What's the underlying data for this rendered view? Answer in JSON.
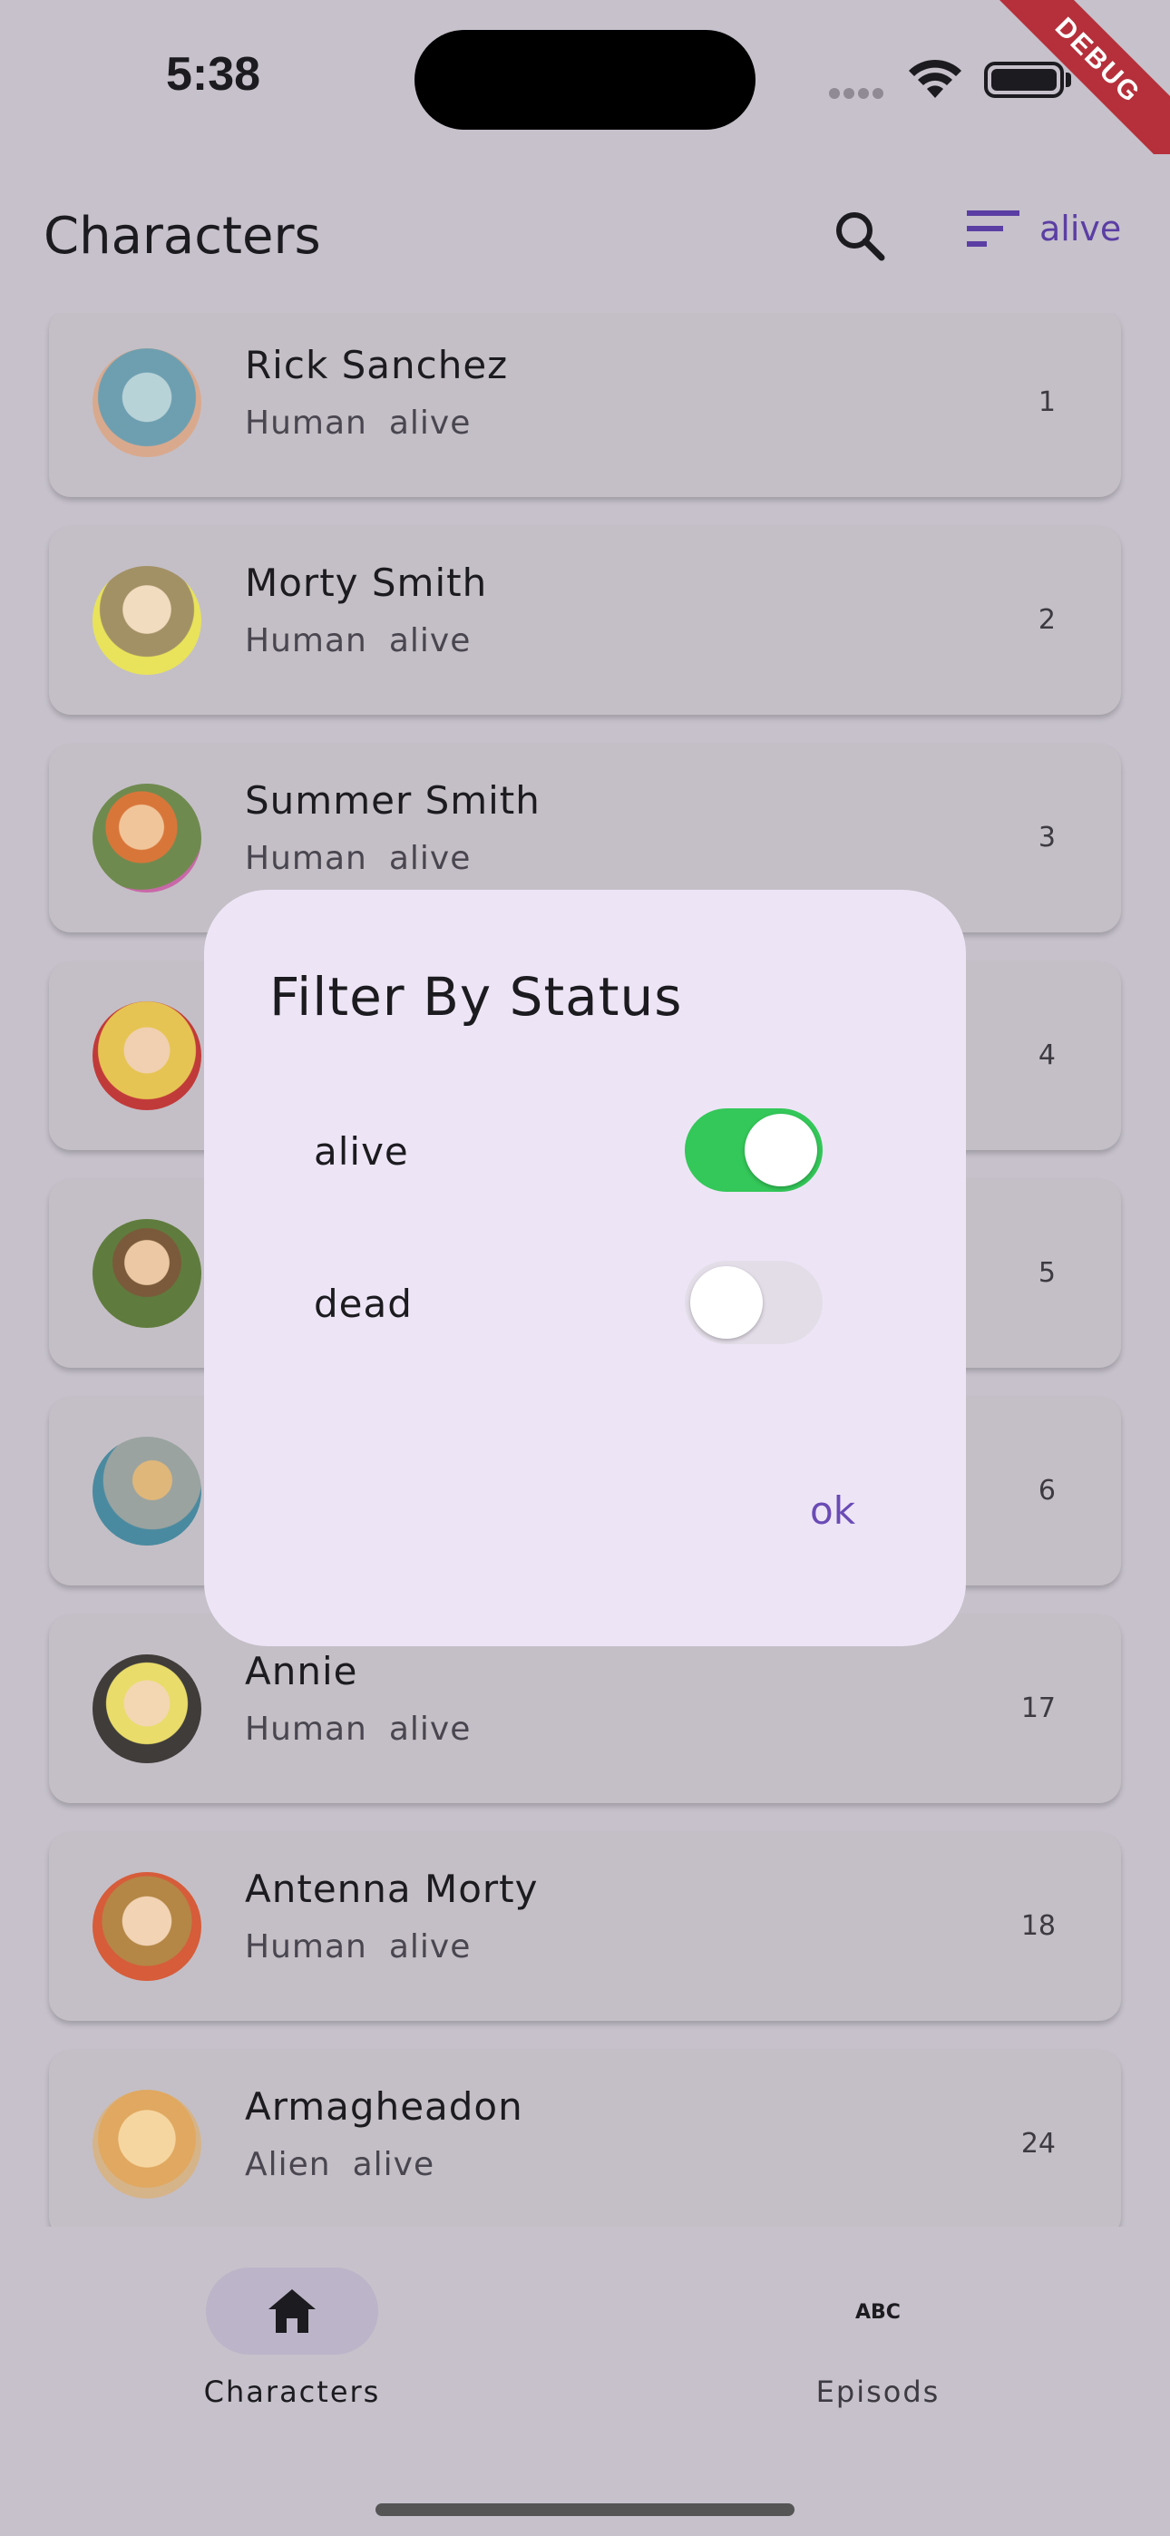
{
  "status_bar": {
    "time": "5:38",
    "debug": "DEBUG"
  },
  "app_bar": {
    "title": "Characters",
    "search_icon": "search-icon",
    "filter_icon": "sort-lines-icon",
    "filter_label": "alive"
  },
  "characters": [
    {
      "name": "Rick Sanchez",
      "species": "Human",
      "status": "alive",
      "id": "1",
      "avatar_color": "#6e9fb0"
    },
    {
      "name": "Morty Smith",
      "species": "Human",
      "status": "alive",
      "id": "2",
      "avatar_color": "#a39166"
    },
    {
      "name": "Summer Smith",
      "species": "Human",
      "status": "alive",
      "id": "3",
      "avatar_color": "#6f8a4f"
    },
    {
      "name": "",
      "species": "",
      "status": "",
      "id": "4",
      "avatar_color": "#c9a54a"
    },
    {
      "name": "",
      "species": "",
      "status": "",
      "id": "5",
      "avatar_color": "#5f7c3e"
    },
    {
      "name": "",
      "species": "",
      "status": "",
      "id": "6",
      "avatar_color": "#9aa3a0"
    },
    {
      "name": "Annie",
      "species": "Human",
      "status": "alive",
      "id": "17",
      "avatar_color": "#7b7252"
    },
    {
      "name": "Antenna Morty",
      "species": "Human",
      "status": "alive",
      "id": "18",
      "avatar_color": "#b48746"
    },
    {
      "name": "Armagheadon",
      "species": "Alien",
      "status": "alive",
      "id": "24",
      "avatar_color": "#d6b48a"
    }
  ],
  "dialog": {
    "title": "Filter By Status",
    "options": [
      {
        "label": "alive",
        "on": true
      },
      {
        "label": "dead",
        "on": false
      }
    ],
    "ok_label": "ok"
  },
  "bottom_nav": {
    "items": [
      {
        "label": "Characters",
        "icon": "home-icon",
        "active": true
      },
      {
        "label": "Episods",
        "icon": "abc-icon",
        "active": false
      }
    ]
  },
  "colors": {
    "accent": "#5b3ea3",
    "switch_on": "#34c759",
    "dialog_bg": "#ede5f6",
    "scrim_bg": "#c6c1cb"
  }
}
